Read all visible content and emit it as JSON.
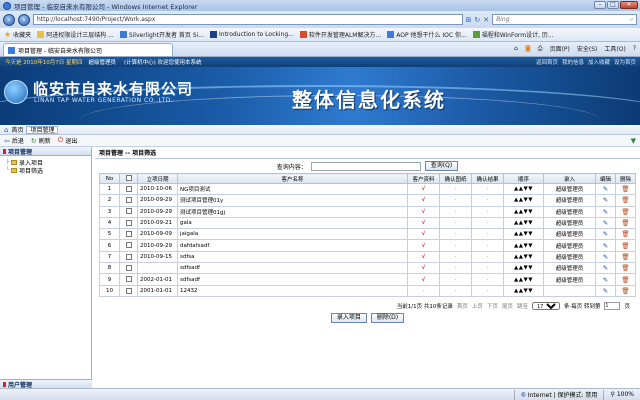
{
  "window": {
    "title": "项目管理 - 临安自来水有限公司 - Windows Internet Explorer",
    "min": "–",
    "max": "□",
    "close": "✕"
  },
  "address": {
    "url": "http://localhost:7490/Project/Work.aspx",
    "search_placeholder": "Bing"
  },
  "favorites": {
    "label": "收藏夹",
    "items": [
      "阿进权限设计三层结构 ...",
      "Silverlight开发者 首页 Si...",
      "Introduction to Locking...",
      "软件开发管理ALM解决方...",
      "AOP 他想干什么 IOC 你...",
      "福程和WinForm设计, 历..."
    ]
  },
  "tab": {
    "label": "项目管理 - 临安自来水有限公司",
    "tools": [
      "页面(P)",
      "安全(S)",
      "工具(O)"
    ]
  },
  "topstrip": {
    "date": "今天是 2010年10月7日 星期四",
    "user": "超级管理员",
    "notice": "(计算机中心) 欢迎您使用本系统",
    "links": [
      "返回首页",
      "我的信息",
      "加入收藏",
      "设为首页"
    ]
  },
  "banner": {
    "company": "临安市自来水有限公司",
    "company_en": "LINAN TAP WATER GENERATION CO.,LTD.",
    "system": "整体信息化系统"
  },
  "crumb": {
    "home": "首页",
    "tab": "项目管理"
  },
  "toolbar": {
    "back": "后退",
    "refresh": "刷新",
    "exit": "退出"
  },
  "sidebar": {
    "header": "项目管理",
    "items": [
      "录入项目",
      "项目筛选"
    ],
    "footer": "用户管理"
  },
  "content": {
    "header": "项目管理 -- 项目筛选",
    "query_label": "查询内容：",
    "query_value": "",
    "query_button": "查询(Q)"
  },
  "table": {
    "columns": [
      "No",
      "",
      "立项日期",
      "客户名称",
      "客户资料",
      "确认图纸",
      "确认结果",
      "顺序",
      "录入",
      "编辑",
      "删除"
    ],
    "rows": [
      {
        "no": "1",
        "date": "2010-10-06",
        "name": "NG项目测试",
        "c1": "√",
        "c2": "·",
        "c3": "·",
        "order": "▲▲▼▼",
        "entry": "超级管理员"
      },
      {
        "no": "2",
        "date": "2010-09-29",
        "name": "测试项目管理01y",
        "c1": "√",
        "c2": "·",
        "c3": "·",
        "order": "▲▲▼▼",
        "entry": "超级管理员"
      },
      {
        "no": "3",
        "date": "2010-09-29",
        "name": "测试项目管理01gj",
        "c1": "√",
        "c2": "·",
        "c3": "·",
        "order": "▲▲▼▼",
        "entry": "超级管理员"
      },
      {
        "no": "4",
        "date": "2010-09-21",
        "name": "gala",
        "c1": "√",
        "c2": "·",
        "c3": "·",
        "order": "▲▲▼▼",
        "entry": "超级管理员"
      },
      {
        "no": "5",
        "date": "2010-09-09",
        "name": "jaigala",
        "c1": "√",
        "c2": "·",
        "c3": "·",
        "order": "▲▲▼▼",
        "entry": "超级管理员"
      },
      {
        "no": "6",
        "date": "2010-09-29",
        "name": "dafdafsadf",
        "c1": "√",
        "c2": "·",
        "c3": "·",
        "order": "▲▲▼▼",
        "entry": "超级管理员"
      },
      {
        "no": "7",
        "date": "2010-09-15",
        "name": "sdfsa",
        "c1": "√",
        "c2": "·",
        "c3": "·",
        "order": "▲▲▼▼",
        "entry": "超级管理员"
      },
      {
        "no": "8",
        "date": "",
        "name": "sdfsadf",
        "c1": "√",
        "c2": "·",
        "c3": "·",
        "order": "▲▲▼▼",
        "entry": "超级管理员"
      },
      {
        "no": "9",
        "date": "2002-01-01",
        "name": "sdfsadf",
        "c1": "√",
        "c2": "·",
        "c3": "·",
        "order": "▲▲▼▼",
        "entry": "超级管理员"
      },
      {
        "no": "10",
        "date": "2001-01-01",
        "name": "12432",
        "c1": "·",
        "c2": "·",
        "c3": "·",
        "order": "▲▲▼▼",
        "entry": ""
      }
    ]
  },
  "pager": {
    "info": "当前1/1页 共10条记录",
    "first": "首页",
    "prev": "上页",
    "next": "下页",
    "last": "尾页",
    "jump": "跳至",
    "per_page_value": "17",
    "per_page_label": "条·每页 转到第",
    "goto_value": "1",
    "page_suffix": "页"
  },
  "actions": {
    "add": "录入项目",
    "delete": "删除(D)"
  },
  "status": {
    "left": "",
    "zone": "Internet | 保护模式: 禁用",
    "zoom": "100%"
  },
  "colors": {
    "accent": "#1d5a9c",
    "tick": "#d21c1c"
  }
}
